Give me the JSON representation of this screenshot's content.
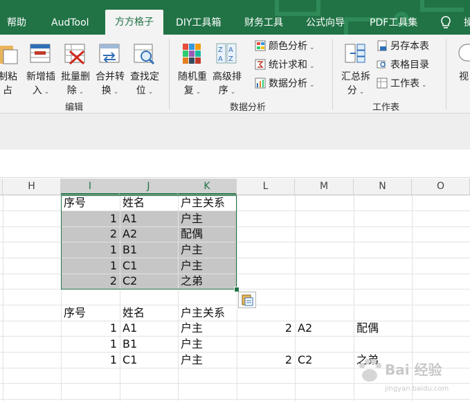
{
  "ribbon_tabs": [
    {
      "label": "帮助",
      "active": false
    },
    {
      "label": "AudTool",
      "active": false
    },
    {
      "label": "方方格子",
      "active": true
    },
    {
      "label": "DIY工具箱",
      "active": false
    },
    {
      "label": "财务工具",
      "active": false
    },
    {
      "label": "公式向导",
      "active": false
    },
    {
      "label": "PDF工具集",
      "active": false
    },
    {
      "label": "操",
      "active": false
    }
  ],
  "tab_icon": "lightbulb-icon",
  "accent_color": "#217346",
  "ribbon": {
    "group_edit": {
      "label": "编辑",
      "buttons": [
        {
          "line1": "制粘",
          "line2": "占",
          "icon": "copy-paste-icon"
        },
        {
          "line1": "新增插",
          "line2": "入",
          "icon": "insert-row-icon"
        },
        {
          "line1": "批量删",
          "line2": "除",
          "icon": "batch-delete-icon"
        },
        {
          "line1": "合并转",
          "line2": "换",
          "icon": "merge-convert-icon"
        },
        {
          "line1": "查找定",
          "line2": "位",
          "icon": "find-locate-icon"
        }
      ]
    },
    "group_analysis": {
      "label": "数据分析",
      "buttons": [
        {
          "line1": "随机重",
          "line2": "复",
          "icon": "random-repeat-icon"
        },
        {
          "line1": "高级排",
          "line2": "序",
          "icon": "advanced-sort-icon"
        }
      ],
      "small": [
        {
          "label": "颜色分析",
          "icon": "color-analysis-icon"
        },
        {
          "label": "统计求和",
          "icon": "stat-sum-icon"
        },
        {
          "label": "数据分析",
          "icon": "data-analysis-icon"
        }
      ]
    },
    "group_sheet": {
      "label": "工作表",
      "buttons": [
        {
          "line1": "汇总拆",
          "line2": "分",
          "icon": "summary-split-icon"
        }
      ],
      "small": [
        {
          "label": "另存本表",
          "icon": "save-sheet-icon"
        },
        {
          "label": "表格目录",
          "icon": "sheet-directory-icon"
        },
        {
          "label": "工作表",
          "icon": "worksheet-icon"
        }
      ]
    },
    "group_view": {
      "buttons": [
        {
          "line1": "视",
          "line2": "",
          "icon": "view-icon"
        }
      ]
    }
  },
  "columns": [
    "H",
    "I",
    "J",
    "K",
    "L",
    "M",
    "N",
    "O"
  ],
  "selected_columns": [
    "I",
    "J",
    "K"
  ],
  "table1": {
    "headers": [
      "序号",
      "姓名",
      "户主关系"
    ],
    "rows": [
      [
        "1",
        "A1",
        "户主"
      ],
      [
        "2",
        "A2",
        "配偶"
      ],
      [
        "1",
        "B1",
        "户主"
      ],
      [
        "1",
        "C1",
        "户主"
      ],
      [
        "2",
        "C2",
        "之弟"
      ]
    ]
  },
  "table2": {
    "headers": [
      "序号",
      "姓名",
      "户主关系"
    ],
    "rows": [
      {
        "I": "1",
        "J": "A1",
        "K": "户主",
        "L": "2",
        "M": "A2",
        "N": "配偶"
      },
      {
        "I": "1",
        "J": "B1",
        "K": "户主",
        "L": "",
        "M": "",
        "N": ""
      },
      {
        "I": "1",
        "J": "C1",
        "K": "户主",
        "L": "2",
        "M": "C2",
        "N": "之弟"
      }
    ]
  },
  "paste_options_icon": "paste-options-icon",
  "watermark": {
    "main": "Bai 经验",
    "sub": "jingyan.baidu.com"
  }
}
